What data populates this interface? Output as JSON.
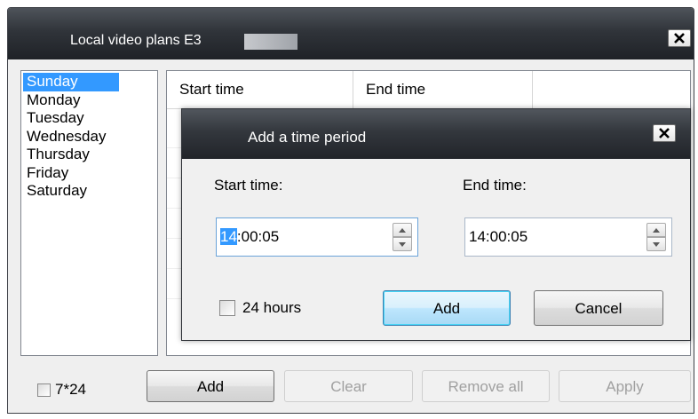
{
  "main_window": {
    "title": "Local video plans E3",
    "days": [
      "Sunday",
      "Monday",
      "Tuesday",
      "Wednesday",
      "Thursday",
      "Friday",
      "Saturday"
    ],
    "selected_day": "Sunday",
    "table": {
      "columns": [
        "Start time",
        "End time"
      ]
    },
    "option_7x24_label": "7*24",
    "buttons": {
      "add": "Add",
      "clear": "Clear",
      "remove_all": "Remove all",
      "apply": "Apply"
    }
  },
  "dialog": {
    "title": "Add a time period",
    "start_label": "Start time:",
    "end_label": "End time:",
    "start_value": {
      "hour_selected": "14",
      "rest": ":00:05"
    },
    "end_value": "14:00:05",
    "hours24_label": "24 hours",
    "add_button": "Add",
    "cancel_button": "Cancel"
  },
  "colors": {
    "selection": "#3399ff",
    "titlebar_dark": "#1f2227",
    "window_bg": "#efefef"
  }
}
